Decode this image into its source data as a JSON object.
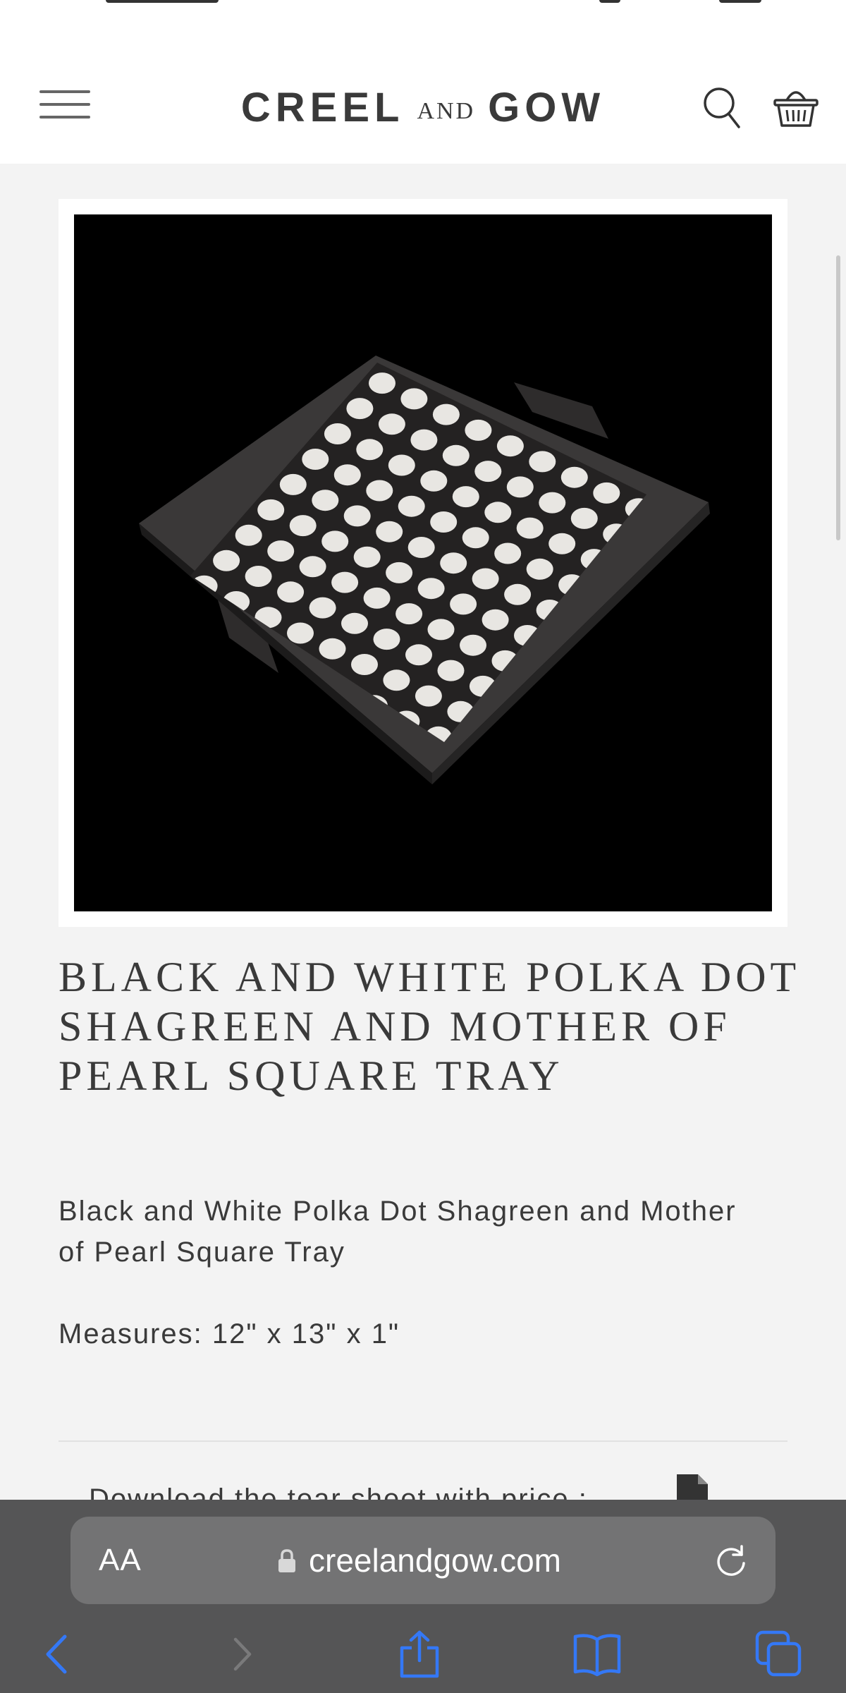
{
  "site": {
    "logo_left": "CREEL",
    "logo_and": "AND",
    "logo_right": "GOW"
  },
  "product": {
    "title": "BLACK AND WHITE POLKA DOT SHAGREEN AND MOTHER OF PEARL SQUARE TRAY",
    "description": "Black and White Polka Dot Shagreen and Mother of Pearl Square Tray",
    "measures": "Measures: 12\" x 13\" x 1\"",
    "tearsheet_text": "Download the tear sheet with price :"
  },
  "browser": {
    "text_size_label": "AA",
    "url": "creelandgow.com"
  },
  "colors": {
    "header_bg": "#ffffff",
    "page_bg": "#f3f3f3",
    "text": "#3a3a3a",
    "browser_bar": "#555556",
    "url_pill": "#737374",
    "toolbar_accent": "#3478f6"
  },
  "icons": [
    "menu-icon",
    "search-icon",
    "basket-icon",
    "document-icon",
    "lock-icon",
    "reload-icon",
    "back-icon",
    "forward-icon",
    "share-icon",
    "bookmarks-icon",
    "tabs-icon"
  ]
}
